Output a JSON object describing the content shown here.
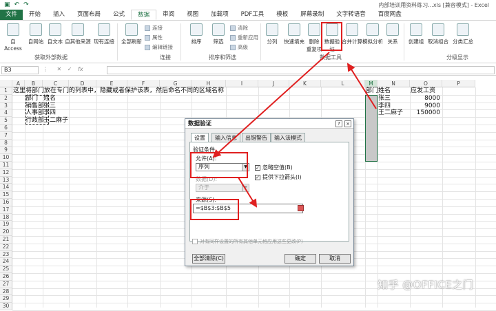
{
  "window": {
    "qat_icons": [
      "save-icon",
      "undo-icon",
      "redo-icon"
    ],
    "title": "内部培训用资料练习...xls [兼容模式] - Excel"
  },
  "tabs": [
    {
      "label": "文件",
      "kind": "file"
    },
    {
      "label": "开始",
      "kind": ""
    },
    {
      "label": "插入",
      "kind": ""
    },
    {
      "label": "页面布局",
      "kind": ""
    },
    {
      "label": "公式",
      "kind": ""
    },
    {
      "label": "数据",
      "kind": "active"
    },
    {
      "label": "审阅",
      "kind": ""
    },
    {
      "label": "视图",
      "kind": ""
    },
    {
      "label": "加载项",
      "kind": ""
    },
    {
      "label": "PDF工具",
      "kind": ""
    },
    {
      "label": "模板",
      "kind": ""
    },
    {
      "label": "屏幕录制",
      "kind": ""
    },
    {
      "label": "文字转语音",
      "kind": ""
    },
    {
      "label": "百度网盘",
      "kind": ""
    }
  ],
  "ribbon": {
    "buttons": {
      "access": "自 Access",
      "web": "自网站",
      "text": "自文本",
      "other": "自其他来源",
      "existing": "现有连接",
      "refresh_all": "全部刷新",
      "sort": "排序",
      "filter": "筛选",
      "split": "分列",
      "flash_fill": "快速填充",
      "remove_dup_1": "删除",
      "remove_dup_2": "重复项",
      "validation_1": "数据验",
      "validation_2": "证",
      "consolidate": "合并计算",
      "whatif": "模拟分析",
      "relations": "关系",
      "group": "创建组",
      "ungroup": "取消组合",
      "subtotal": "分类汇总"
    },
    "small": {
      "connections": "连接",
      "properties": "属性",
      "edit_links": "编辑链接",
      "clear": "清除",
      "reapply": "重新应用",
      "advanced": "高级"
    },
    "groups": {
      "external": "获取外部数据",
      "connections": "连接",
      "sort_filter": "排序和筛选",
      "data_tools": "数据工具",
      "outline": "分级显示"
    }
  },
  "formula_bar": {
    "name_box": "B3",
    "fx": "fx",
    "value": ""
  },
  "grid": {
    "columns": [
      "A",
      "B",
      "C",
      "D",
      "E",
      "F",
      "G",
      "H",
      "I",
      "J",
      "K",
      "L",
      "M",
      "N",
      "O",
      "P"
    ],
    "rows": [
      "1",
      "2",
      "3",
      "4",
      "5",
      "6",
      "7",
      "8",
      "9",
      "10",
      "11",
      "12",
      "13",
      "14",
      "15",
      "16",
      "17",
      "18",
      "19",
      "20",
      "21",
      "22",
      "23",
      "24",
      "25",
      "26",
      "27",
      "28",
      "29",
      "30"
    ],
    "instruction": "这里将部门放在专门的列表中，隐藏或者保护该表，然后命名不同的区域名称",
    "b_column": [
      "部门",
      "销售部",
      "人事部",
      "行政部"
    ],
    "c_column": [
      "姓名",
      "张三",
      "李四",
      "王二麻子"
    ],
    "m1": "部门",
    "n_column": [
      "姓名",
      "张三",
      "李四",
      "王二麻子"
    ],
    "o_column": [
      "应发工资",
      "8000",
      "9000",
      "150000"
    ]
  },
  "dialog": {
    "title": "数据验证",
    "help": "?",
    "close": "×",
    "tabs": [
      "设置",
      "输入信息",
      "出错警告",
      "输入法模式"
    ],
    "criteria": "验证条件",
    "allow_label": "允许(A):",
    "allow_value": "序列",
    "ignore_blank": "忽略空值(B)",
    "dropdown": "提供下拉箭头(I)",
    "data_label": "数据(D):",
    "data_value": "介于",
    "source_label": "来源(S):",
    "source_value": "=$B$3:$B$5",
    "apply_all": "对有同样设置的所有其他单元格应用这些更改(P)",
    "clear_all": "全部清除(C)",
    "ok": "确定",
    "cancel": "取消"
  },
  "watermark": "知乎 @OFFICE之门"
}
